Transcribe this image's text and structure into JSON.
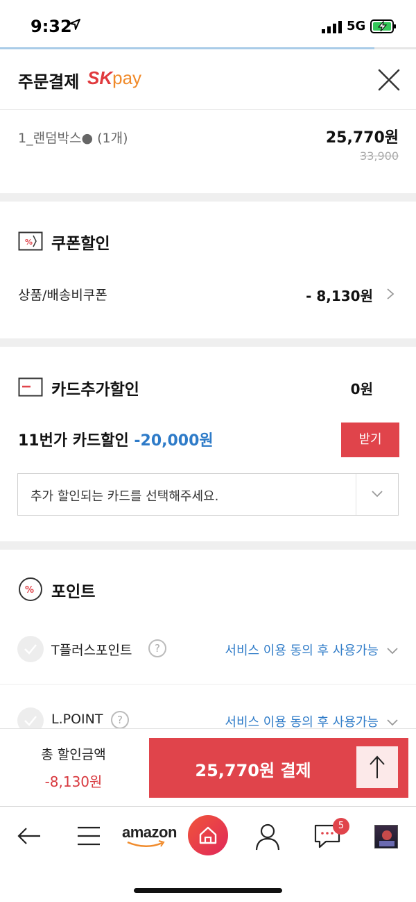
{
  "status_bar": {
    "time": "9:32",
    "network": "5G",
    "page_scroll_progress_percent": 90
  },
  "header": {
    "title": "주문결제",
    "logo_sk": "SK",
    "logo_pay": "pay"
  },
  "product": {
    "name": "1_랜덤박스● (1개)",
    "price": "25,770원",
    "original_price": "33,900"
  },
  "coupon": {
    "title": "쿠폰할인",
    "row_label": "상품/배송비쿠폰",
    "row_value": "- 8,130원"
  },
  "card_discount": {
    "title": "카드추가할인",
    "value": "0원",
    "promo_label": "11번가 카드할인",
    "promo_amount": "-20,000원",
    "receive_button": "받기",
    "select_placeholder": "추가 할인되는 카드를 선택해주세요."
  },
  "points": {
    "title": "포인트",
    "items": [
      {
        "name": "T플러스포인트",
        "status": "서비스 이용 동의 후 사용가능"
      },
      {
        "name": "L.POINT",
        "status": "서비스 이용 동의 후 사용가능"
      }
    ]
  },
  "pay_bar": {
    "total_label": "총 할인금액",
    "total_value": "-8,130원",
    "pay_button": "25,770원 결제"
  },
  "bottom_nav": {
    "amazon_label": "amazon",
    "chat_badge": "5"
  },
  "colors": {
    "accent_red": "#e0444b",
    "link_blue": "#2e7bc8",
    "discount_red": "#d8393f"
  }
}
